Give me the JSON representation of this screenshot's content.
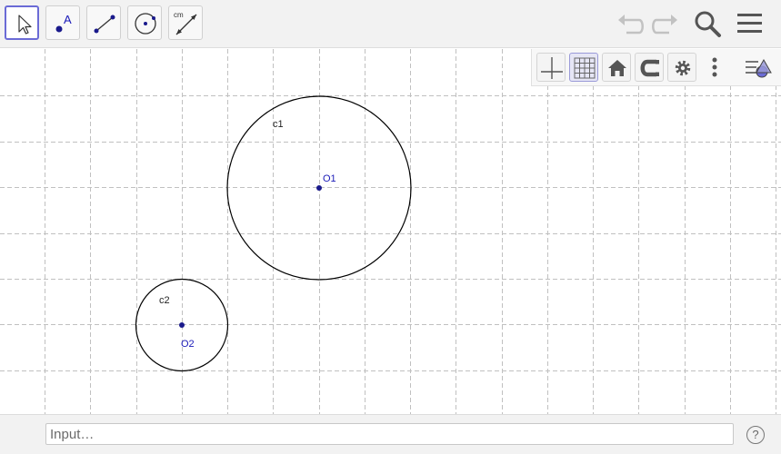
{
  "toolbar": {
    "tools": [
      {
        "icon": "move-arrow-icon",
        "label": "Move"
      },
      {
        "icon": "point-icon",
        "label": "Point",
        "glyph": "A"
      },
      {
        "icon": "segment-icon",
        "label": "Segment"
      },
      {
        "icon": "circle-with-center-icon",
        "label": "Circle with Center through Point"
      },
      {
        "icon": "distance-icon",
        "label": "Distance or Length",
        "glyph": "cm"
      }
    ],
    "right": [
      "undo-icon",
      "redo-icon",
      "search-icon",
      "menu-icon"
    ]
  },
  "style_bar": {
    "buttons": [
      "show-axes-icon",
      "show-grid-icon",
      "home-icon",
      "point-capturing-icon",
      "settings-icon",
      "more-icon",
      "toggle-style-bar-icon"
    ],
    "grid_active": true
  },
  "canvas": {
    "objects": [
      {
        "name": "c1",
        "type": "circle",
        "center": "O1"
      },
      {
        "name": "c2",
        "type": "circle",
        "center": "O2"
      },
      {
        "name": "O1",
        "type": "point"
      },
      {
        "name": "O2",
        "type": "point"
      }
    ],
    "labels": {
      "c1": "c1",
      "c2": "c2",
      "O1": "O1",
      "O2": "O2"
    },
    "colors": {
      "circle": "#000000",
      "point": "#1a1a8c",
      "grid": "#c0c0c0",
      "point_label": "#1a1ab8"
    }
  },
  "input_bar": {
    "placeholder": "Input…",
    "value": "",
    "help_glyph": "?"
  }
}
